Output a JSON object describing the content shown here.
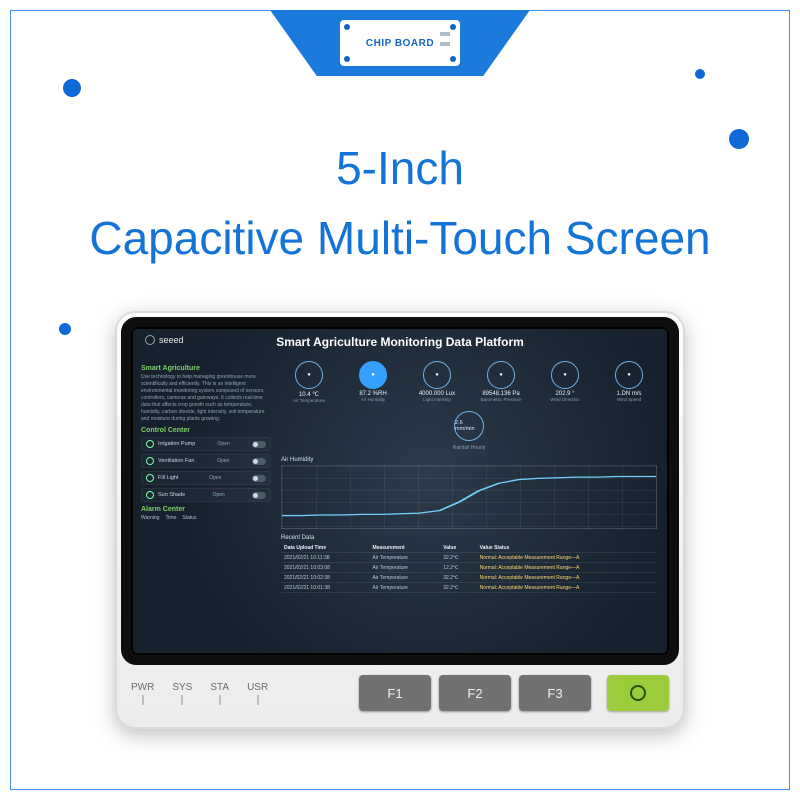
{
  "banner_label": "CHIP BOARD",
  "title_line1": "5-Inch",
  "title_line2": "Capacitive Multi-Touch Screen",
  "device": {
    "brand": "seeed",
    "header": "Smart Agriculture Monitoring Data Platform",
    "leds": [
      "PWR",
      "SYS",
      "STA",
      "USR"
    ],
    "f_buttons": [
      "F1",
      "F2",
      "F3"
    ]
  },
  "sidebar": {
    "sec1_title": "Smart Agriculture",
    "sec1_text": "Use technology to help managing greenhouse more scientifically and efficiently. This is an intelligent environmental monitoring system composed of sensors, controllers, cameras and gateways. It collects real-time data that affects crop growth such as temperature, humidity, carbon dioxide, light intensity, soil temperature and moisture during plants growing.",
    "sec2_title": "Control Center",
    "controls": [
      "Irrigation Pump",
      "Ventilation Fan",
      "Fill Light",
      "Sun Shade"
    ],
    "toggle_label": "Open",
    "sec3_title": "Alarm Center",
    "alarm_cols": [
      "Warning",
      "Time",
      "Status"
    ]
  },
  "metrics": [
    {
      "value": "10.4 ℃",
      "label": "Air Temperature"
    },
    {
      "value": "87.2 %RH",
      "label": "Air Humidity",
      "active": true
    },
    {
      "value": "4000.000 Lux",
      "label": "Light Intensity"
    },
    {
      "value": "89548.136 Pa",
      "label": "Barometric Pressure"
    },
    {
      "value": "202.9 °",
      "label": "Wind Direction"
    },
    {
      "value": "1.DN m/s",
      "label": "Wind Speed"
    }
  ],
  "rain": {
    "value": "2.6 mm/min",
    "label": "Rainfall Hourly"
  },
  "chart_data": {
    "type": "line",
    "title": "Air Humidity",
    "xlabel": "",
    "ylabel": "",
    "ylim": [
      0,
      100
    ],
    "x": [
      0,
      1,
      2,
      3,
      4,
      5,
      6,
      7,
      8,
      9,
      10,
      11,
      12,
      13,
      14,
      15,
      16,
      17,
      18,
      19
    ],
    "values": [
      20,
      20,
      21,
      21,
      22,
      22,
      23,
      24,
      28,
      42,
      60,
      72,
      78,
      80,
      81,
      82,
      82,
      83,
      83,
      83
    ]
  },
  "table": {
    "title": "Recent Data",
    "headers": [
      "Data Upload Time",
      "Measurement",
      "Value",
      "Value Status"
    ],
    "rows": [
      [
        "2021/02/21 10:11:38",
        "Air Temperature",
        "32.2℃",
        "Normal: Acceptable Measurement Range—A"
      ],
      [
        "2021/02/21 10:03:08",
        "Air Temperature",
        "12.2℃",
        "Normal: Acceptable Measurement Range—A"
      ],
      [
        "2021/02/21 10:02:38",
        "Air Temperature",
        "32.2℃",
        "Normal: Acceptable Measurement Range—A"
      ],
      [
        "2021/02/21 10:01:38",
        "Air Temperature",
        "32.2℃",
        "Normal: Acceptable Measurement Range—A"
      ]
    ]
  }
}
